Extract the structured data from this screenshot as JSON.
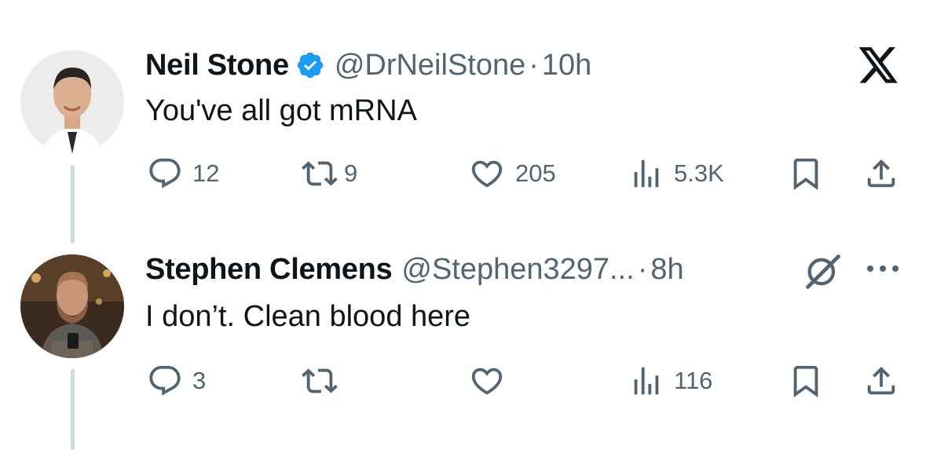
{
  "tweet1": {
    "display_name": "Neil Stone",
    "handle": "@DrNeilStone",
    "separator": "·",
    "time": "10h",
    "verified": true,
    "text": "You've all got mRNA",
    "replies": "12",
    "reposts": "9",
    "likes": "205",
    "views": "5.3K"
  },
  "tweet2": {
    "display_name": "Stephen Clemens",
    "handle": "@Stephen3297...",
    "separator": "·",
    "time": "8h",
    "text": "I don’t. Clean blood here",
    "replies": "3",
    "views": "116"
  },
  "colors": {
    "text_primary": "#0f1419",
    "text_secondary": "#536471",
    "verified_blue": "#1d9bf0",
    "thread_line": "#cfd9de"
  },
  "icons": {
    "brand": "x-logo-icon",
    "reply": "reply-icon",
    "repost": "repost-icon",
    "like": "heart-icon",
    "views": "views-chart-icon",
    "bookmark": "bookmark-icon",
    "share": "share-icon",
    "grok": "grok-icon",
    "more": "more-icon"
  }
}
